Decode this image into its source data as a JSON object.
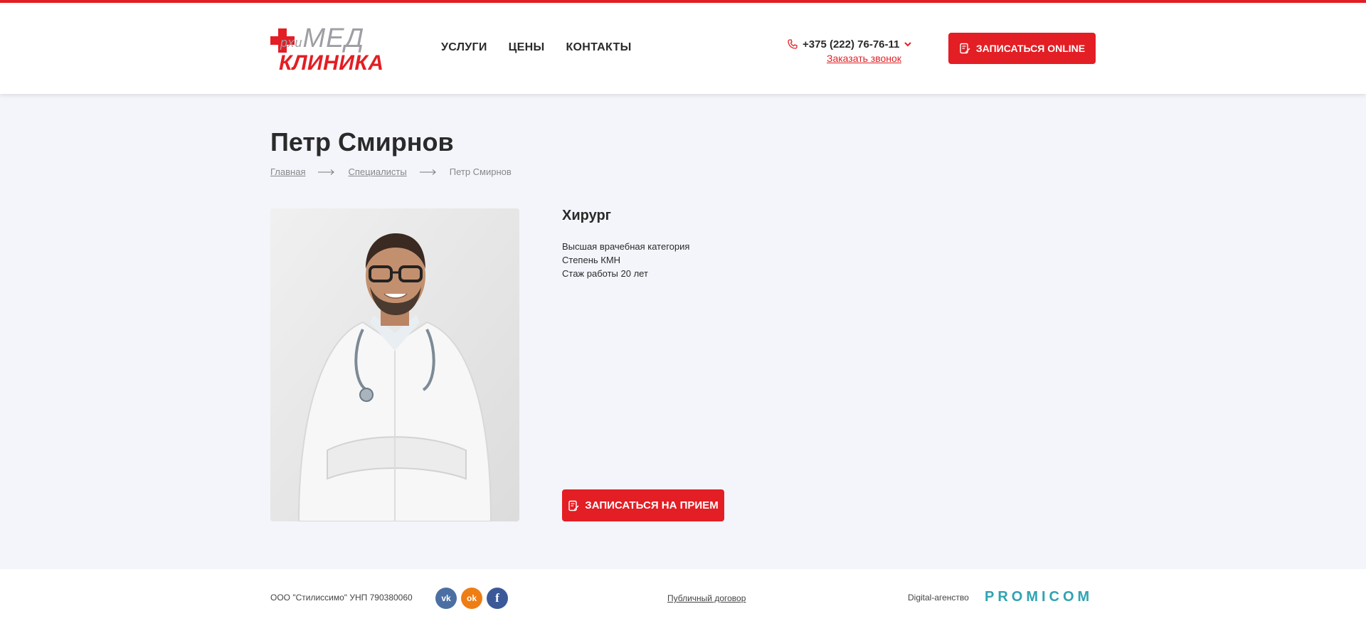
{
  "brand": {
    "logo_top": "рхиМЕД",
    "logo_top_small": "рхи",
    "logo_top_big": "МЕД",
    "logo_bottom": "КЛИНИКА",
    "accent_color": "#e31e24"
  },
  "nav": {
    "items": [
      {
        "label": "УСЛУГИ"
      },
      {
        "label": "ЦЕНЫ"
      },
      {
        "label": "КОНТАКТЫ"
      }
    ]
  },
  "contact": {
    "phone": "+375 (222) 76-76-11",
    "callback_label": "Заказать звонок"
  },
  "header": {
    "online_button": "ЗАПИСАТЬСЯ ONLINE"
  },
  "page": {
    "title": "Петр Смирнов"
  },
  "breadcrumb": {
    "items": [
      {
        "label": "Главная"
      },
      {
        "label": "Специалисты"
      },
      {
        "label": "Петр Смирнов"
      }
    ]
  },
  "doctor": {
    "specialty": "Хирург",
    "details": [
      "Высшая врачебная категория",
      "Степень КМН",
      "Стаж работы 20 лет"
    ],
    "appointment_button": "ЗАПИСАТЬСЯ НА ПРИЕМ"
  },
  "footer": {
    "company": "ООО \"Стилиссимо\" УНП 790380060",
    "socials": [
      {
        "icon": "vk-icon"
      },
      {
        "icon": "odnoklassniki-icon"
      },
      {
        "icon": "facebook-icon"
      }
    ],
    "contract": "Публичный договор",
    "agency_label": "Digital-агенство",
    "agency_logo": "PROMICOM"
  }
}
